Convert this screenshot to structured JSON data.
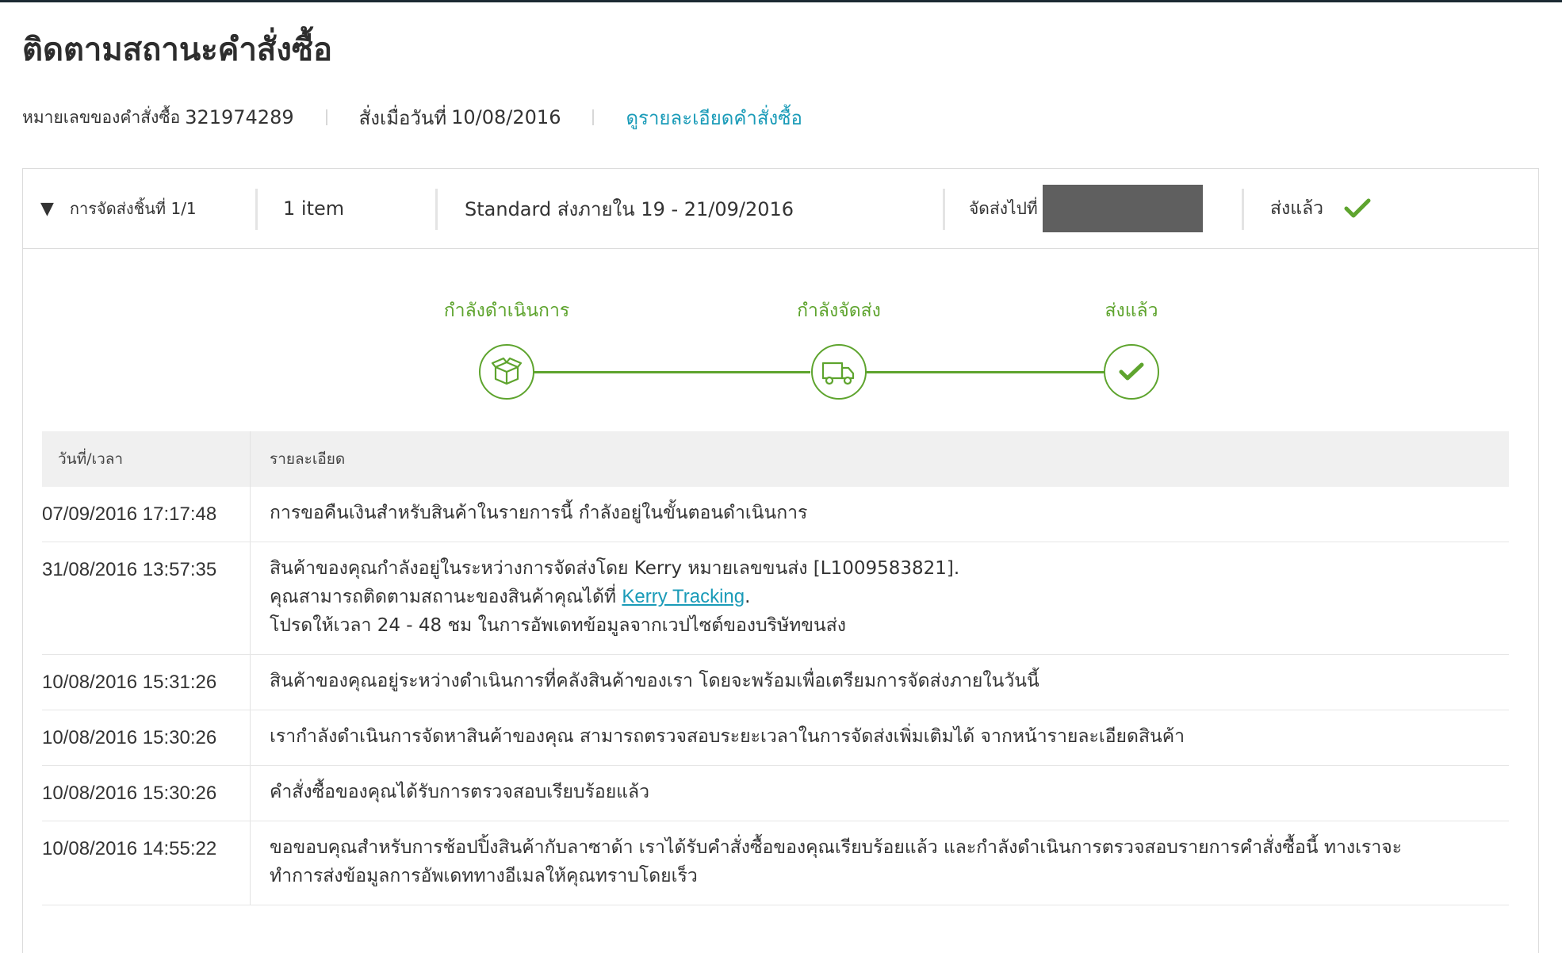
{
  "page": {
    "title": "ติดตามสถานะคำสั่งซื้อ"
  },
  "order": {
    "number_label": "หมายเลขของคำสั่งซื้อ",
    "number_value": "321974289",
    "date_label": "สั่งเมื่อวันที่",
    "date_value": "10/08/2016",
    "details_link": "ดูรายละเอียดคำสั่งซื้อ"
  },
  "package": {
    "toggle_icon": "triangle-down-icon",
    "label": "การจัดส่งชิ้นที่ 1/1",
    "items": "1 item",
    "delivery": "Standard ส่งภายใน 19 - 21/09/2016",
    "ship_to_label": "จัดส่งไปที่",
    "status": "ส่งแล้ว",
    "status_icon": "checkmark-icon"
  },
  "progress": {
    "steps": [
      {
        "label": "กำลังดำเนินการ",
        "icon": "box-icon"
      },
      {
        "label": "กำลังจัดส่ง",
        "icon": "truck-icon"
      },
      {
        "label": "ส่งแล้ว",
        "icon": "checkmark-icon"
      }
    ],
    "accent_color": "#5ea42e"
  },
  "history": {
    "columns": {
      "date": "วันที่/เวลา",
      "detail": "รายละเอียด"
    },
    "rows": [
      {
        "date": "07/09/2016 17:17:48",
        "lines": [
          "การขอคืนเงินสำหรับสินค้าในรายการนี้ กำลังอยู่ในขั้นตอนดำเนินการ"
        ]
      },
      {
        "date": "31/08/2016 13:57:35",
        "line1": "สินค้าของคุณกำลังอยู่ในระหว่างการจัดส่งโดย Kerry หมายเลขขนส่ง [L1009583821].",
        "line2_prefix": "คุณสามารถติดตามสถานะของสินค้าคุณได้ที่ ",
        "line2_link": "Kerry Tracking",
        "line2_suffix": ".",
        "line3": "โปรดให้เวลา 24 - 48 ชม ในการอัพเดทข้อมูลจากเวปไซต์ของบริษัทขนส่ง"
      },
      {
        "date": "10/08/2016 15:31:26",
        "lines": [
          "สินค้าของคุณอยู่ระหว่างดำเนินการที่คลังสินค้าของเรา โดยจะพร้อมเพื่อเตรียมการจัดส่งภายในวันนี้"
        ]
      },
      {
        "date": "10/08/2016 15:30:26",
        "lines": [
          "เรากำลังดำเนินการจัดหาสินค้าของคุณ สามารถตรวจสอบระยะเวลาในการจัดส่งเพิ่มเติมได้ จากหน้ารายละเอียดสินค้า"
        ]
      },
      {
        "date": "10/08/2016 15:30:26",
        "lines": [
          "คำสั่งซื้อของคุณได้รับการตรวจสอบเรียบร้อยแล้ว"
        ]
      },
      {
        "date": "10/08/2016 14:55:22",
        "lines": [
          "ขอขอบคุณสำหรับการช้อปปิ้งสินค้ากับลาซาด้า เราได้รับคำสั่งซื้อของคุณเรียบร้อยแล้ว และกำลังดำเนินการตรวจสอบรายการคำสั่งซื้อนี้ ทางเราจะ",
          "ทำการส่งข้อมูลการอัพเดททางอีเมลให้คุณทราบโดยเร็ว"
        ]
      }
    ]
  }
}
